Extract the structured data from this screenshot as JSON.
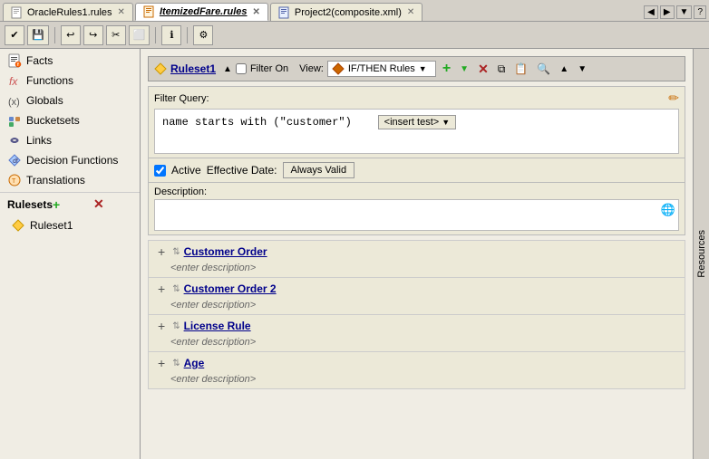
{
  "tabs": [
    {
      "id": "oracle-rules",
      "label": "OracleRules1.rules",
      "icon": "rules",
      "active": false
    },
    {
      "id": "itemized-fare",
      "label": "ItemizedFare.rules",
      "icon": "rules",
      "active": true
    },
    {
      "id": "project2",
      "label": "Project2(composite.xml)",
      "icon": "composite",
      "active": false
    }
  ],
  "toolbar": {
    "buttons": [
      "check",
      "floppy",
      "undo",
      "redo",
      "cut",
      "copy",
      "info",
      "build"
    ]
  },
  "left_panel": {
    "items": [
      {
        "id": "facts",
        "label": "Facts",
        "icon": "facts"
      },
      {
        "id": "functions",
        "label": "Functions",
        "icon": "functions"
      },
      {
        "id": "globals",
        "label": "Globals",
        "icon": "globals"
      },
      {
        "id": "bucketsets",
        "label": "Bucketsets",
        "icon": "bucketsets"
      },
      {
        "id": "links",
        "label": "Links",
        "icon": "links"
      },
      {
        "id": "decision-functions",
        "label": "Decision Functions",
        "icon": "decision-functions"
      },
      {
        "id": "translations",
        "label": "Translations",
        "icon": "translations"
      }
    ],
    "rulesets_label": "Rulesets",
    "ruleset_items": [
      {
        "id": "ruleset1",
        "label": "Ruleset1"
      }
    ]
  },
  "ruleset": {
    "name": "Ruleset1",
    "filter_on": false,
    "view_label": "View:",
    "view_value": "IF/THEN Rules",
    "filter_query_label": "Filter Query:",
    "filter_query": "name  starts with  (\"customer\")",
    "insert_test_label": "<insert test>",
    "active_checked": true,
    "active_label": "Active",
    "effective_date_label": "Effective Date:",
    "always_valid_label": "Always Valid",
    "description_label": "Description:",
    "rules": [
      {
        "id": "customer-order",
        "name": "Customer Order",
        "desc": "<enter description>"
      },
      {
        "id": "customer-order2",
        "name": "Customer Order 2",
        "desc": "<enter description>"
      },
      {
        "id": "license-rule",
        "name": "License Rule",
        "desc": "<enter description>"
      },
      {
        "id": "age",
        "name": "Age",
        "desc": "<enter description>"
      }
    ]
  },
  "resources_label": "Resources"
}
